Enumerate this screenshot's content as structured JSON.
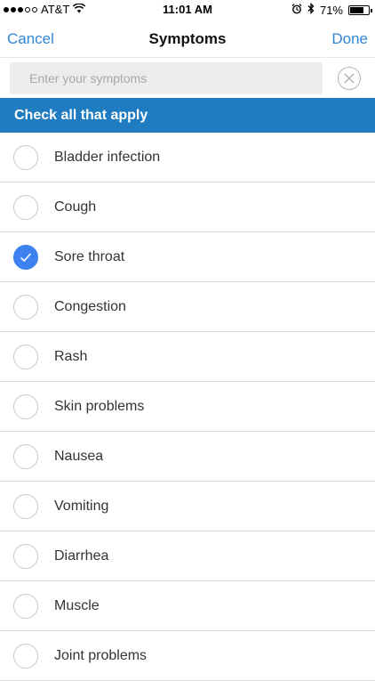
{
  "status": {
    "carrier": "AT&T",
    "time": "11:01 AM",
    "battery": "71%"
  },
  "nav": {
    "cancel_label": "Cancel",
    "title": "Symptoms",
    "done_label": "Done"
  },
  "search": {
    "placeholder": "Enter your symptoms"
  },
  "banner": {
    "text": "Check all that apply"
  },
  "symptoms": [
    {
      "label": "Bladder infection",
      "checked": false
    },
    {
      "label": "Cough",
      "checked": false
    },
    {
      "label": "Sore throat",
      "checked": true
    },
    {
      "label": "Congestion",
      "checked": false
    },
    {
      "label": "Rash",
      "checked": false
    },
    {
      "label": "Skin problems",
      "checked": false
    },
    {
      "label": "Nausea",
      "checked": false
    },
    {
      "label": "Vomiting",
      "checked": false
    },
    {
      "label": "Diarrhea",
      "checked": false
    },
    {
      "label": "Muscle",
      "checked": false
    },
    {
      "label": "Joint problems",
      "checked": false
    }
  ],
  "colors": {
    "accent": "#2f86d6",
    "banner": "#1f7cc0",
    "checked": "#3d82f0"
  },
  "icons": {
    "clear": "close-circle-icon",
    "check": "checkmark-icon",
    "wifi": "wifi-icon",
    "alarm": "alarm-icon",
    "bluetooth": "bluetooth-icon",
    "battery": "battery-icon"
  }
}
